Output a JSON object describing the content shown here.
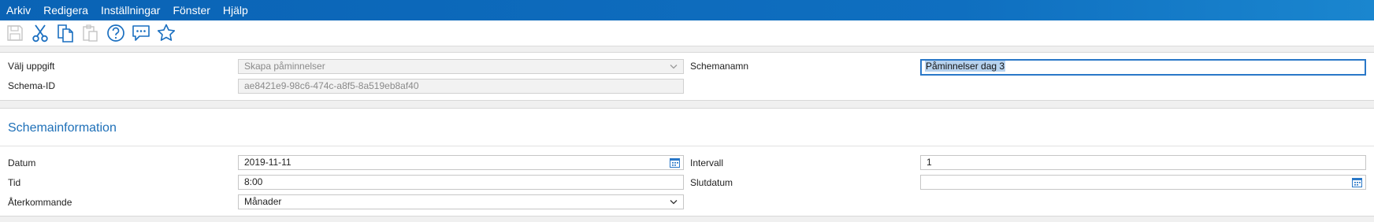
{
  "menu": [
    "Arkiv",
    "Redigera",
    "Inställningar",
    "Fönster",
    "Hjälp"
  ],
  "toolbar": {
    "icons": [
      "save-icon",
      "cut-icon",
      "copy-icon",
      "paste-icon",
      "help-icon",
      "chat-icon",
      "star-icon"
    ]
  },
  "task": {
    "choose_task_label": "Välj uppgift",
    "choose_task_value": "Skapa påminnelser",
    "schema_id_label": "Schema-ID",
    "schema_id_value": "ae8421e9-98c6-474c-a8f5-8a519eb8af40",
    "schema_name_label": "Schemanamn",
    "schema_name_value": "Påminnelser dag 3"
  },
  "schedule": {
    "title": "Schemainformation",
    "date_label": "Datum",
    "date_value": "2019-11-11",
    "time_label": "Tid",
    "time_value": "8:00",
    "recurring_label": "Återkommande",
    "recurring_value": "Månader",
    "interval_label": "Intervall",
    "interval_value": "1",
    "end_date_label": "Slutdatum",
    "end_date_value": ""
  },
  "colors": {
    "menubar": "#0a63b5",
    "accent": "#1e70b8",
    "selection": "#b7d2ee"
  }
}
